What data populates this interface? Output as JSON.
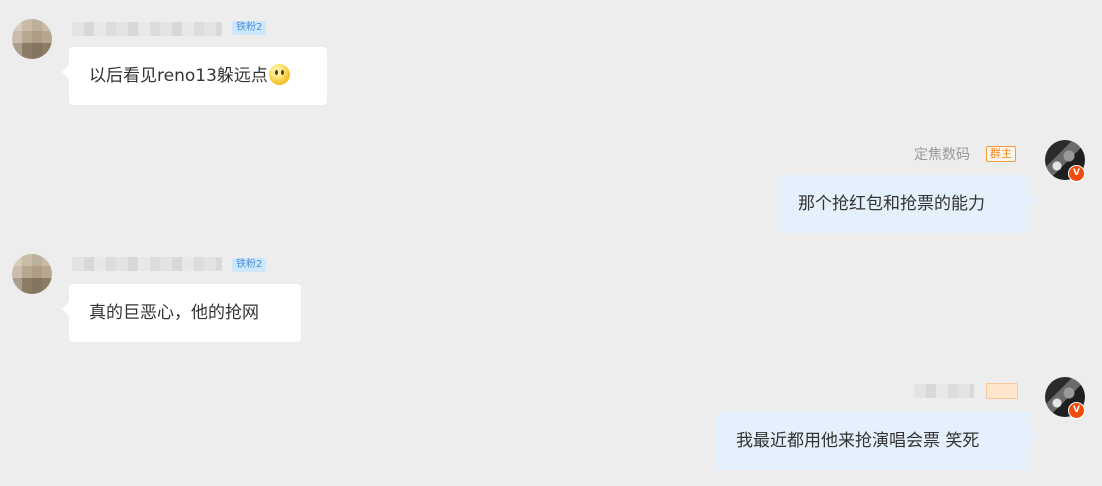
{
  "messages": [
    {
      "side": "left",
      "sender_badge": "铁粉2",
      "text": "以后看见reno13躲远点",
      "emoji": "smiley-icon"
    },
    {
      "side": "right",
      "sender_name": "定焦数码",
      "role_badge": "群主",
      "verified": "V",
      "text": "那个抢红包和抢票的能力"
    },
    {
      "side": "left",
      "sender_badge": "铁粉2",
      "text": "真的巨恶心，他的抢网"
    },
    {
      "side": "right",
      "verified": "V",
      "text": "我最近都用他来抢演唱会票 笑死"
    }
  ],
  "colors": {
    "background": "#ededed",
    "left_bubble": "#ffffff",
    "right_bubble": "#e4f0fb",
    "role_badge": "#f0861f",
    "verified_badge": "#f04a0f",
    "fan_badge": "#4a90d9"
  }
}
